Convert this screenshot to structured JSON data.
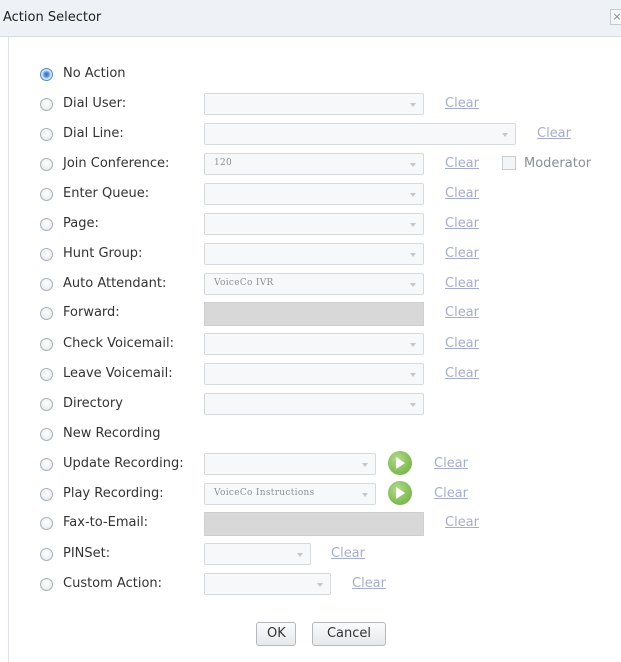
{
  "window": {
    "title": "Action Selector",
    "close_glyph": "×"
  },
  "rows": [
    {
      "label": "No Action",
      "checked": true
    },
    {
      "label": "Dial User:",
      "clear": "Clear"
    },
    {
      "label": "Dial Line:",
      "clear": "Clear"
    },
    {
      "label": "Join Conference:",
      "value": "120",
      "clear": "Clear",
      "moderator": "Moderator"
    },
    {
      "label": "Enter Queue:",
      "clear": "Clear"
    },
    {
      "label": "Page:",
      "clear": "Clear"
    },
    {
      "label": "Hunt Group:",
      "clear": "Clear"
    },
    {
      "label": "Auto Attendant:",
      "value": "VoiceCo IVR",
      "clear": "Clear"
    },
    {
      "label": "Forward:",
      "clear": "Clear"
    },
    {
      "label": "Check Voicemail:",
      "clear": "Clear"
    },
    {
      "label": "Leave Voicemail:",
      "clear": "Clear"
    },
    {
      "label": "Directory"
    },
    {
      "label": "New Recording"
    },
    {
      "label": "Update Recording:",
      "clear": "Clear"
    },
    {
      "label": "Play Recording:",
      "value": "VoiceCo Instructions",
      "clear": "Clear"
    },
    {
      "label": "Fax-to-Email:",
      "clear": "Clear"
    },
    {
      "label": "PINSet:",
      "clear": "Clear"
    },
    {
      "label": "Custom Action:",
      "clear": "Clear"
    }
  ],
  "buttons": {
    "ok": "OK",
    "cancel": "Cancel"
  },
  "colors": {
    "link": "#a6adc9",
    "accent_radio": "#2d6fc1",
    "play": "#86c05a"
  }
}
